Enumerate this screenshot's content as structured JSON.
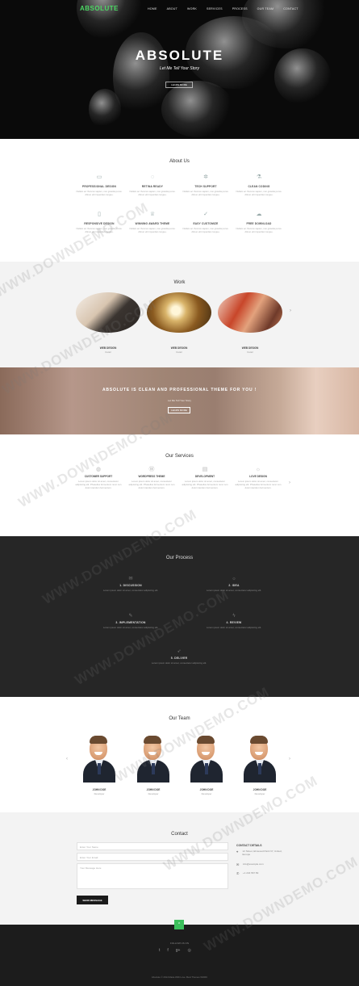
{
  "nav": {
    "brand": "ABSOLUTE",
    "links": [
      "HOME",
      "ABOUT",
      "WORK",
      "SERVICES",
      "PROCESS",
      "OUR TEAM",
      "CONTACT"
    ]
  },
  "hero": {
    "title": "ABSOLUTE",
    "subtitle": "Let Me Tell Your Story",
    "button": "LEARN MORE"
  },
  "about": {
    "title": "About Us",
    "features": [
      {
        "icon": "monitor-icon",
        "title": "PROFESSIONAL DESIGN",
        "text": "Nullam ac rhoncus sapien, non gravida purus. Alinon elit imperdiet congue."
      },
      {
        "icon": "chat-icon",
        "title": "RETINA READY",
        "text": "Nullam ac rhoncus sapien, non gravida purus. Alinon elit imperdiet congue."
      },
      {
        "icon": "gears-icon",
        "title": "TECH SUPPORT",
        "text": "Nullam ac rhoncus sapien, non gravida purus. Alinon elit imperdiet congue."
      },
      {
        "icon": "flask-icon",
        "title": "CLEAN CODING",
        "text": "Nullam ac rhoncus sapien, non gravida purus. Alinon elit imperdiet congue."
      },
      {
        "icon": "mobile-icon",
        "title": "RESPONSIVE DESIGN",
        "text": "Nullam ac rhoncus sapien, non gravida purus. Alinon elit imperdiet congue."
      },
      {
        "icon": "trophy-icon",
        "title": "WINNING AWARD THEME",
        "text": "Nullam ac rhoncus sapien, non gravida purus. Alinon elit imperdiet congue."
      },
      {
        "icon": "thumbs-up-icon",
        "title": "EASY CUSTOMIZE",
        "text": "Nullam ac rhoncus sapien, non gravida purus. Alinon elit imperdiet congue."
      },
      {
        "icon": "cloud-download-icon",
        "title": "FREE DOWNLOAD",
        "text": "Nullam ac rhoncus sapien, non gravida purus. Alinon elit imperdiet congue."
      }
    ]
  },
  "work": {
    "title": "Work",
    "items": [
      {
        "title": "WEB DESIGN",
        "subtitle": "Detail"
      },
      {
        "title": "WEB DESIGN",
        "subtitle": "Detail"
      },
      {
        "title": "WEB DESIGN",
        "subtitle": "Detail"
      }
    ]
  },
  "banner": {
    "headline": "ABSOLUTE IS CLEAN AND PROFESSIONAL THEME FOR YOU !",
    "subtitle": "Let Me Tell Your Story",
    "button": "LEARN MORE"
  },
  "services": {
    "title": "Our Services",
    "items": [
      {
        "icon": "globe-icon",
        "title": "CUSTOMER SUPPORT",
        "text": "Lorem ipsum dolor sit amet, consectetur adipiscing elit. Phasellus fermentum nunc non dolor interdum fermentum."
      },
      {
        "icon": "wordpress-icon",
        "title": "WORDPRESS THEME",
        "text": "Lorem ipsum dolor sit amet, consectetur adipiscing elit. Phasellus fermentum nunc non dolor interdum fermentum."
      },
      {
        "icon": "book-icon",
        "title": "DEVELOPMENT",
        "text": "Lorem ipsum dolor sit amet, consectetur adipiscing elit. Phasellus fermentum nunc non dolor interdum fermentum."
      },
      {
        "icon": "bulb-icon",
        "title": "LOVE DESIGN",
        "text": "Lorem ipsum dolor sit amet, consectetur adipiscing elit. Phasellus fermentum nunc non dolor interdum fermentum."
      }
    ]
  },
  "process": {
    "title": "Our Process",
    "steps": [
      {
        "icon": "chat-icon",
        "title": "1. DISCUSSION",
        "text": "Lorem ipsum dolor sit amet, consectetur adipiscing elit."
      },
      {
        "icon": "bulb-icon",
        "title": "2. IDEA",
        "text": "Lorem ipsum dolor sit amet, consectetur adipiscing elit."
      },
      {
        "icon": "pencil-icon",
        "title": "3. IMPLEMENTATION",
        "text": "Lorem ipsum dolor sit amet, consectetur adipiscing elit."
      },
      {
        "icon": "lightning-icon",
        "title": "4. REVIEW",
        "text": "Lorem ipsum dolor sit amet, consectetur adipiscing elit."
      },
      {
        "icon": "rocket-icon",
        "title": "5. DELIVER",
        "text": "Lorem ipsum dolor sit amet, consectetur adipiscing elit."
      }
    ]
  },
  "team": {
    "title": "Our Team",
    "members": [
      {
        "name": "JOHN DOE",
        "role": "Developer"
      },
      {
        "name": "JOHN DOE",
        "role": "Developer"
      },
      {
        "name": "JOHN DOE",
        "role": "Developer"
      },
      {
        "name": "JOHN DOE",
        "role": "Developer"
      }
    ]
  },
  "contact": {
    "title": "Contact",
    "name_placeholder": "Enter Your Name",
    "email_placeholder": "Enter Your Email",
    "message_placeholder": "Your Message Here",
    "send_button": "SEND MESSAGE",
    "details_title": "CONTACT DETAILS",
    "address": "12 Street, Elmwood Park NY, United, Europe",
    "email": "info@example.com",
    "phone": "+1 234 567 89"
  },
  "footer": {
    "follow": "FOLLOW US ON",
    "copyright": "Absolute © 2014 Made With Love. Best Themes WORK"
  },
  "watermark": "WWW.DOWNDEMO.COM"
}
